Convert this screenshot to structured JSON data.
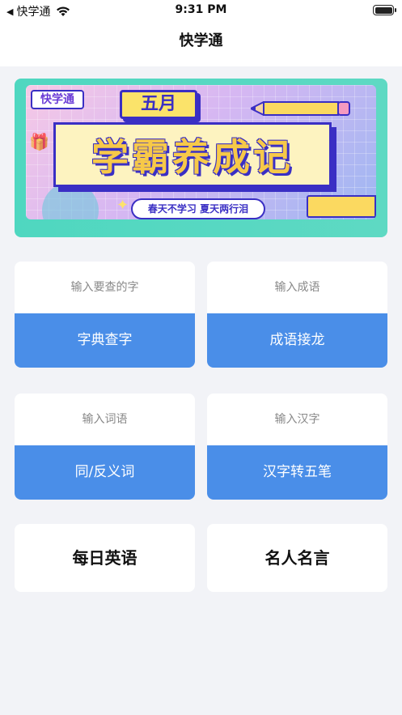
{
  "status_bar": {
    "carrier": "快学通",
    "time": "9:31 PM"
  },
  "nav": {
    "title": "快学通"
  },
  "banner": {
    "brand": "快学通",
    "month": "五月",
    "title": "学霸养成记",
    "slogan": "春天不学习  夏天两行泪"
  },
  "cards": {
    "dictionary": {
      "placeholder": "输入要查的字",
      "button": "字典查字"
    },
    "idiom": {
      "placeholder": "输入成语",
      "button": "成语接龙"
    },
    "synonym": {
      "placeholder": "输入词语",
      "button": "同/反义词"
    },
    "wubi": {
      "placeholder": "输入汉字",
      "button": "汉字转五笔"
    },
    "daily_english": {
      "label": "每日英语"
    },
    "quotes": {
      "label": "名人名言"
    }
  },
  "colors": {
    "accent": "#4a8ee8",
    "background": "#f2f3f7",
    "banner_border": "#3a2fc4"
  }
}
